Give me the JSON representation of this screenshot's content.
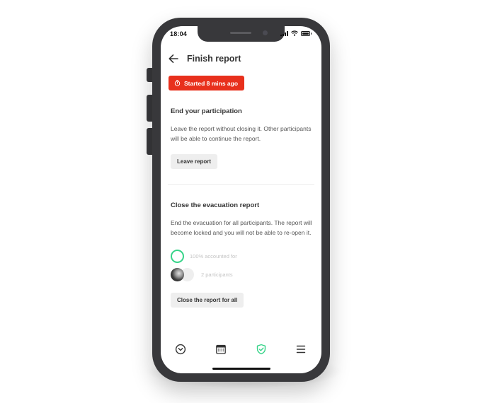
{
  "status_bar": {
    "time": "18:04"
  },
  "header": {
    "title": "Finish report"
  },
  "badge": {
    "label": "Started 8 mins ago",
    "color": "#e8301c"
  },
  "leave_section": {
    "title": "End your participation",
    "description": "Leave the report without closing it. Other participants will be able to continue the report.",
    "button_label": "Leave report"
  },
  "close_section": {
    "title": "Close the evacuation report",
    "description": "End the evacuation for all participants. The report will become locked and you will not be able to re-open it.",
    "accounted_label": "100% accounted for",
    "accounted_fraction": 1.0,
    "participants_label": "2 participants",
    "button_label": "Close the report for all"
  },
  "bottom_nav": {
    "items": [
      {
        "icon": "chevron-down-circle-icon"
      },
      {
        "icon": "calendar-icon"
      },
      {
        "icon": "shield-check-icon",
        "active": true,
        "color": "#39d48a"
      },
      {
        "icon": "hamburger-menu-icon"
      }
    ]
  }
}
